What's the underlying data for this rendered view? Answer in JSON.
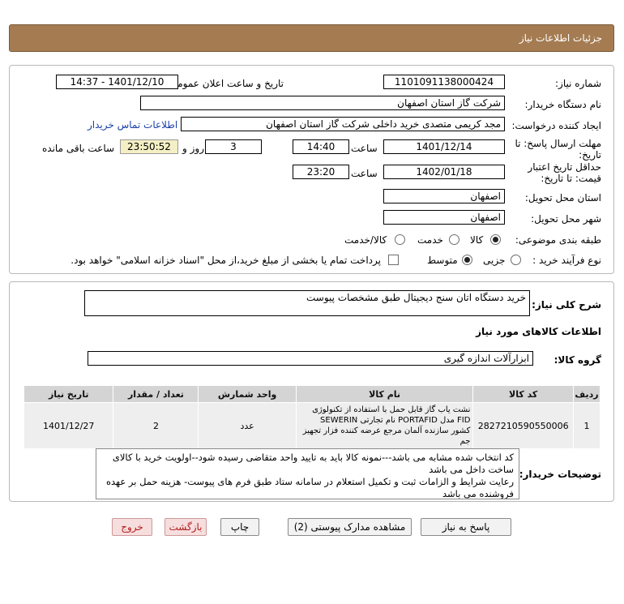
{
  "header": {
    "title": "جزئیات اطلاعات نیاز"
  },
  "form": {
    "need_number_label": "شماره نیاز:",
    "need_number": "1101091138000424",
    "announce_label": "تاریخ و ساعت اعلان عمومی:",
    "announce_value": "1401/12/10 - 14:37",
    "buyer_label": "نام دستگاه خریدار:",
    "buyer_value": "شرکت گاز استان اصفهان",
    "creator_label": "ایجاد کننده درخواست:",
    "creator_value": "مجد کریمی متصدی خرید داخلی شرکت گاز استان اصفهان",
    "contact_link": "اطلاعات تماس خریدار",
    "reply_deadline_label": "مهلت ارسال پاسخ: تا تاریخ:",
    "reply_date": "1401/12/14",
    "time_label": "ساعت",
    "reply_time": "14:40",
    "days_value": "3",
    "days_label": "روز و",
    "remaining_time": "23:50:52",
    "remaining_label": "ساعت باقی مانده",
    "validity_label": "حداقل تاریخ اعتبار قیمت: تا تاریخ:",
    "validity_date": "1402/01/18",
    "validity_time_label": "ساعت",
    "validity_time": "23:20",
    "province_label": "استان محل تحویل:",
    "province_value": "اصفهان",
    "city_label": "شهر محل تحویل:",
    "city_value": "اصفهان",
    "category_label": "طبقه بندی موضوعی:",
    "category_options": [
      "کالا",
      "خدمت",
      "کالا/خدمت"
    ],
    "category_selected": "کالا",
    "process_label": "نوع فرآیند خرید :",
    "process_options": [
      "جزیی",
      "متوسط"
    ],
    "process_selected": "متوسط",
    "payment_note": "پرداخت تمام یا بخشی از مبلغ خرید،از محل \"اسناد خزانه اسلامی\" خواهد بود."
  },
  "need_section": {
    "summary_label": "شرح کلی نیاز:",
    "summary_value": "خرید دستگاه اتان سنج دیجیتال طبق مشخصات پیوست",
    "goods_info_title": "اطلاعات کالاهای مورد نیاز",
    "goods_group_label": "گروه کالا:",
    "goods_group_value": "ابزارآلات اندازه گیری"
  },
  "table": {
    "headers": [
      "ردیف",
      "کد کالا",
      "نام کالا",
      "واحد شمارش",
      "تعداد / مقدار",
      "تاریخ نیاز"
    ],
    "rows": [
      {
        "row": "1",
        "code": "2827210590550006",
        "name": "نشت یاب گاز قابل حمل با استفاده از تکنولوژی FID مدل PORTAFID نام تجارتی SEWERIN کشور سازنده آلمان مرجع عرضه کننده فزار تجهیز جم",
        "unit": "عدد",
        "qty": "2",
        "date": "1401/12/27"
      }
    ]
  },
  "buyer_notes": {
    "label": "توضیحات خریدار:",
    "line1": "کد انتخاب شده مشابه می باشد---نمونه کالا باید به تایید واحد متقاضی رسیده شود--اولویت خرید با کالای ساخت داخل می باشد",
    "line2": "رعایت شرایط و الزامات ثبت و تکمیل استعلام در سامانه ستاد  طبق فرم های پیوست- هزینه حمل بر عهده فروشنده می باشد"
  },
  "buttons": {
    "reply": "پاسخ به نیاز",
    "attachments": "مشاهده مدارک پیوستی (2)",
    "print": "چاپ",
    "back": "بازگشت",
    "exit": "خروج"
  }
}
